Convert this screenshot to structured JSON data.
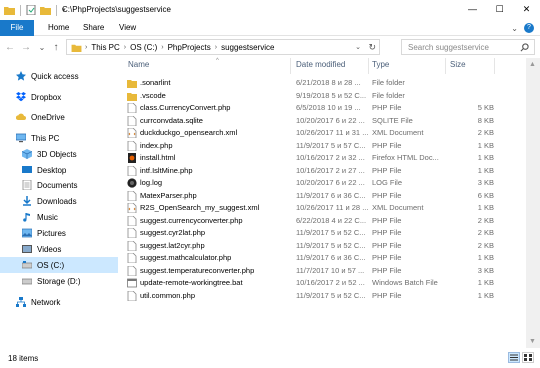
{
  "window": {
    "title": "C:\\PhpProjects\\suggestservice",
    "min_glyph": "—",
    "max_glyph": "☐",
    "close_glyph": "✕"
  },
  "ribbon": {
    "tabs": [
      {
        "label": "File"
      },
      {
        "label": "Home"
      },
      {
        "label": "Share"
      },
      {
        "label": "View"
      }
    ],
    "help_glyph": "?"
  },
  "address": {
    "back_glyph": "←",
    "forward_glyph": "→",
    "up_list_glyph": "⌄",
    "up_glyph": "↑",
    "crumbs": [
      "This PC",
      "OS (C:)",
      "PhpProjects",
      "suggestservice"
    ],
    "sep_glyph": "›",
    "drop_glyph": "⌄",
    "refresh_glyph": "↻",
    "search_placeholder": "Search suggestservice"
  },
  "nav": {
    "items": [
      {
        "label": "Quick access",
        "icon": "star-icon"
      },
      {
        "label": "Dropbox",
        "icon": "dropbox-icon"
      },
      {
        "label": "OneDrive",
        "icon": "cloud-icon"
      },
      {
        "label": "This PC",
        "icon": "computer-icon"
      },
      {
        "label": "3D Objects",
        "icon": "cube-icon"
      },
      {
        "label": "Desktop",
        "icon": "desktop-icon"
      },
      {
        "label": "Documents",
        "icon": "documents-icon"
      },
      {
        "label": "Downloads",
        "icon": "download-icon"
      },
      {
        "label": "Music",
        "icon": "music-icon"
      },
      {
        "label": "Pictures",
        "icon": "pictures-icon"
      },
      {
        "label": "Videos",
        "icon": "videos-icon"
      },
      {
        "label": "OS (C:)",
        "icon": "drive-icon"
      },
      {
        "label": "Storage (D:)",
        "icon": "drive-icon"
      },
      {
        "label": "Network",
        "icon": "network-icon"
      }
    ]
  },
  "columns": {
    "name": "Name",
    "date": "Date modified",
    "type": "Type",
    "size": "Size",
    "sort_glyph": "^"
  },
  "files": [
    {
      "name": ".sonarlint",
      "date": "6/21/2018 8 и 28 ...",
      "type": "File folder",
      "size": "",
      "icon": "folder-icon"
    },
    {
      "name": ".vscode",
      "date": "9/19/2018 5 и 52 C...",
      "type": "File folder",
      "size": "",
      "icon": "folder-icon"
    },
    {
      "name": "class.CurrencyConvert.php",
      "date": "6/5/2018 10 и 19 ...",
      "type": "PHP File",
      "size": "5 KB",
      "icon": "php-file-icon"
    },
    {
      "name": "currconvdata.sqlite",
      "date": "10/20/2017 6 и 22 ...",
      "type": "SQLITE File",
      "size": "8 KB",
      "icon": "file-icon"
    },
    {
      "name": "duckduckgo_opensearch.xml",
      "date": "10/26/2017 11 и 31 ...",
      "type": "XML Document",
      "size": "2 KB",
      "icon": "xml-file-icon"
    },
    {
      "name": "index.php",
      "date": "11/9/2017 5 и 57 C...",
      "type": "PHP File",
      "size": "1 KB",
      "icon": "php-file-icon"
    },
    {
      "name": "install.html",
      "date": "10/16/2017 2 и 32 ...",
      "type": "Firefox HTML Doc...",
      "size": "1 KB",
      "icon": "html-file-icon"
    },
    {
      "name": "intf.IsltMine.php",
      "date": "10/16/2017 2 и 27 ...",
      "type": "PHP File",
      "size": "1 KB",
      "icon": "php-file-icon"
    },
    {
      "name": "log.log",
      "date": "10/20/2017 6 и 22 ...",
      "type": "LOG File",
      "size": "3 KB",
      "icon": "log-file-icon"
    },
    {
      "name": "MatexParser.php",
      "date": "11/9/2017 6 и 36 C...",
      "type": "PHP File",
      "size": "6 KB",
      "icon": "php-file-icon"
    },
    {
      "name": "R2S_OpenSearch_my_suggest.xml",
      "date": "10/26/2017 11 и 28 ...",
      "type": "XML Document",
      "size": "1 KB",
      "icon": "xml-file-icon"
    },
    {
      "name": "suggest.currencyconverter.php",
      "date": "6/22/2018 4 и 22 C...",
      "type": "PHP File",
      "size": "2 KB",
      "icon": "php-file-icon"
    },
    {
      "name": "suggest.cyr2lat.php",
      "date": "11/9/2017 5 и 52 C...",
      "type": "PHP File",
      "size": "2 KB",
      "icon": "php-file-icon"
    },
    {
      "name": "suggest.lat2cyr.php",
      "date": "11/9/2017 5 и 52 C...",
      "type": "PHP File",
      "size": "2 KB",
      "icon": "php-file-icon"
    },
    {
      "name": "suggest.mathcalculator.php",
      "date": "11/9/2017 6 и 36 C...",
      "type": "PHP File",
      "size": "1 KB",
      "icon": "php-file-icon"
    },
    {
      "name": "suggest.temperatureconverter.php",
      "date": "11/7/2017 10 и 57 ...",
      "type": "PHP File",
      "size": "3 KB",
      "icon": "php-file-icon"
    },
    {
      "name": "update-remote-workingtree.bat",
      "date": "10/16/2017 2 и 52 ...",
      "type": "Windows Batch File",
      "size": "1 KB",
      "icon": "bat-file-icon"
    },
    {
      "name": "util.common.php",
      "date": "11/9/2017 5 и 52 C...",
      "type": "PHP File",
      "size": "1 KB",
      "icon": "php-file-icon"
    }
  ],
  "status": {
    "item_count": "18 items"
  },
  "colors": {
    "accent": "#1979ca",
    "selection": "#cce8ff",
    "folder": "#e8b93a",
    "header_text": "#4c607a"
  }
}
